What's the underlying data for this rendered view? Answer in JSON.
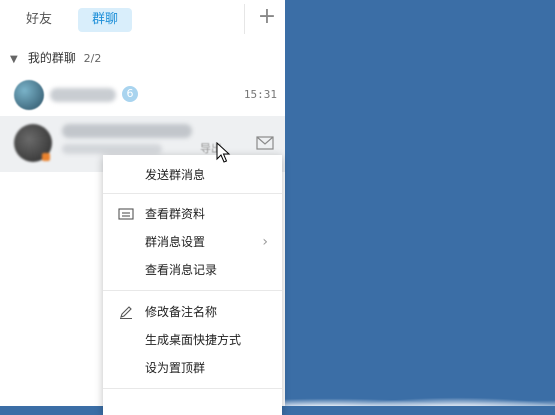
{
  "tabs": {
    "friends": "好友",
    "groups": "群聊",
    "add": "+"
  },
  "section": {
    "title": "我的群聊",
    "count": "2/2"
  },
  "chats": [
    {
      "badge": "6",
      "time": "15:31"
    },
    {
      "tag": "导出"
    }
  ],
  "context_menu": {
    "items": [
      {
        "label": "发送群消息",
        "icon": null
      },
      {
        "label": "查看群资料",
        "icon": "id-card-icon"
      },
      {
        "label": "群消息设置",
        "icon": null,
        "submenu": true
      },
      {
        "label": "查看消息记录",
        "icon": null
      },
      {
        "label": "修改备注名称",
        "icon": "pencil-icon"
      },
      {
        "label": "生成桌面快捷方式",
        "icon": null
      },
      {
        "label": "设为置顶群",
        "icon": null
      }
    ]
  },
  "colors": {
    "accent": "#1e8fd8",
    "tab_active_bg": "#d9eefb",
    "desktop_bg": "#3b6ea6",
    "badge": "#a9d4ef"
  }
}
